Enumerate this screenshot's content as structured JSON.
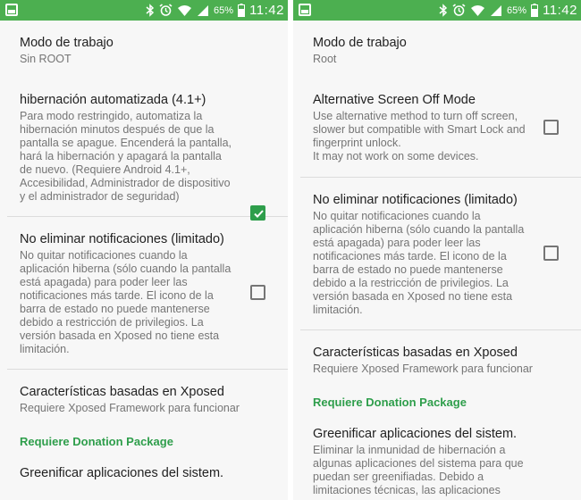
{
  "status_bar": {
    "battery_percent": "65%",
    "time": "11:42",
    "icons": [
      "screenshot-icon",
      "bluetooth-icon",
      "alarm-icon",
      "wifi-icon",
      "signal-icon",
      "battery-icon"
    ],
    "color": "#4caf50"
  },
  "accent_color": "#2e9e4b",
  "left": {
    "items": [
      {
        "title": "Modo de trabajo",
        "summary": "Sin ROOT"
      },
      {
        "title": "hibernación automatizada (4.1+)",
        "summary": "Para modo restringido, automatiza la hibernación minutos después de que la pantalla se apague. Encenderá la pantalla, hará la hibernación y apagará la pantalla de nuevo. (Requiere Android 4.1+, Accesibilidad, Administrador de dispositivo y el administrador de seguridad)",
        "checked": true
      },
      {
        "title": "No eliminar notificaciones (limitado)",
        "summary": "No quitar notificaciones cuando la aplicación hiberna (sólo cuando la pantalla está apagada) para poder leer las notificaciones más tarde. El icono de la barra de estado no puede mantenerse debido a restricción de privilegios. La versión basada en Xposed no tiene esta limitación.",
        "checked": false
      },
      {
        "title": "Características basadas en Xposed",
        "summary": "Requiere Xposed Framework para funcionar"
      }
    ],
    "category": "Requiere Donation Package",
    "partial_title": "Greenificar aplicaciones del sistem."
  },
  "right": {
    "items": [
      {
        "title": "Modo de trabajo",
        "summary": "Root"
      },
      {
        "title": "Alternative Screen Off Mode",
        "summary": "Use alternative method to turn off screen, slower but compatible with Smart Lock and fingerprint unlock.\nIt may not work on some devices.",
        "checked": false
      },
      {
        "title": "No eliminar notificaciones (limitado)",
        "summary": "No quitar notificaciones cuando la aplicación hiberna (sólo cuando la pantalla está apagada) para poder leer las notificaciones más tarde. El icono de la barra de estado no puede mantenerse debido a la restricción de privilegios. La versión basada en Xposed no tiene esta limitación.",
        "checked": false
      },
      {
        "title": "Características basadas en Xposed",
        "summary": "Requiere Xposed Framework para funcionar"
      }
    ],
    "category": "Requiere Donation Package",
    "last_item": {
      "title": "Greenificar aplicaciones del sistem.",
      "summary": "Eliminar la inmunidad de hibernación a algunas aplicaciones del sistema para que puedan ser greenifiadas. Debido a limitaciones técnicas, las aplicaciones"
    }
  }
}
